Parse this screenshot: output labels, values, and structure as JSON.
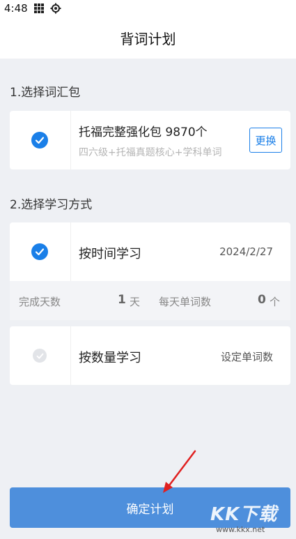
{
  "status_bar": {
    "time": "4:48"
  },
  "header": {
    "title": "背词计划"
  },
  "section1": {
    "title": "1.选择词汇包",
    "package": {
      "name": "托福完整强化包 9870个",
      "desc": "四六级+托福真题核心+学科单词",
      "change_label": "更换",
      "selected": true
    }
  },
  "section2": {
    "title": "2.选择学习方式",
    "by_time": {
      "label": "按时间学习",
      "value": "2024/2/27",
      "selected": true
    },
    "stats": {
      "days_label": "完成天数",
      "days_value": "1",
      "days_unit": "天",
      "words_label": "每天单词数",
      "words_value": "0",
      "words_unit": "个"
    },
    "by_count": {
      "label": "按数量学习",
      "value": "设定单词数",
      "selected": false
    }
  },
  "footer": {
    "confirm_label": "确定计划"
  },
  "watermark": {
    "text": "KK下载",
    "url": "www.kkx.net"
  },
  "colors": {
    "accent": "#1a7fe8",
    "button": "#4e8fdc",
    "arrow": "#e02020"
  }
}
